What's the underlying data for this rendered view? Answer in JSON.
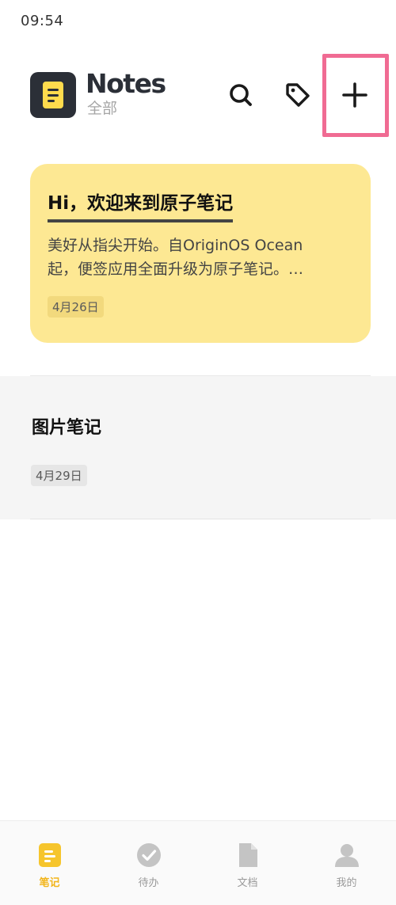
{
  "status_bar": {
    "time": "09:54"
  },
  "header": {
    "title": "Notes",
    "subtitle": "全部",
    "icons": [
      "search-icon",
      "tag-icon",
      "add-icon"
    ]
  },
  "notes": [
    {
      "title": "Hi，欢迎来到原子笔记",
      "preview": "美好从指尖开始。自OriginOS Ocean\n起，便签应用全面升级为原子笔记。…",
      "date": "4月26日",
      "color": "#fde893"
    },
    {
      "title": "图片笔记",
      "date": "4月29日",
      "color": "#f5f5f5"
    }
  ],
  "bottom_nav": {
    "items": [
      {
        "label": "笔记",
        "icon": "note-icon",
        "active": true
      },
      {
        "label": "待办",
        "icon": "check-circle-icon",
        "active": false
      },
      {
        "label": "文档",
        "icon": "document-icon",
        "active": false
      },
      {
        "label": "我的",
        "icon": "person-icon",
        "active": false
      }
    ]
  },
  "colors": {
    "accent": "#f2b51c",
    "highlight_box": "#f06b93",
    "logo_bg": "#2b2f37"
  }
}
